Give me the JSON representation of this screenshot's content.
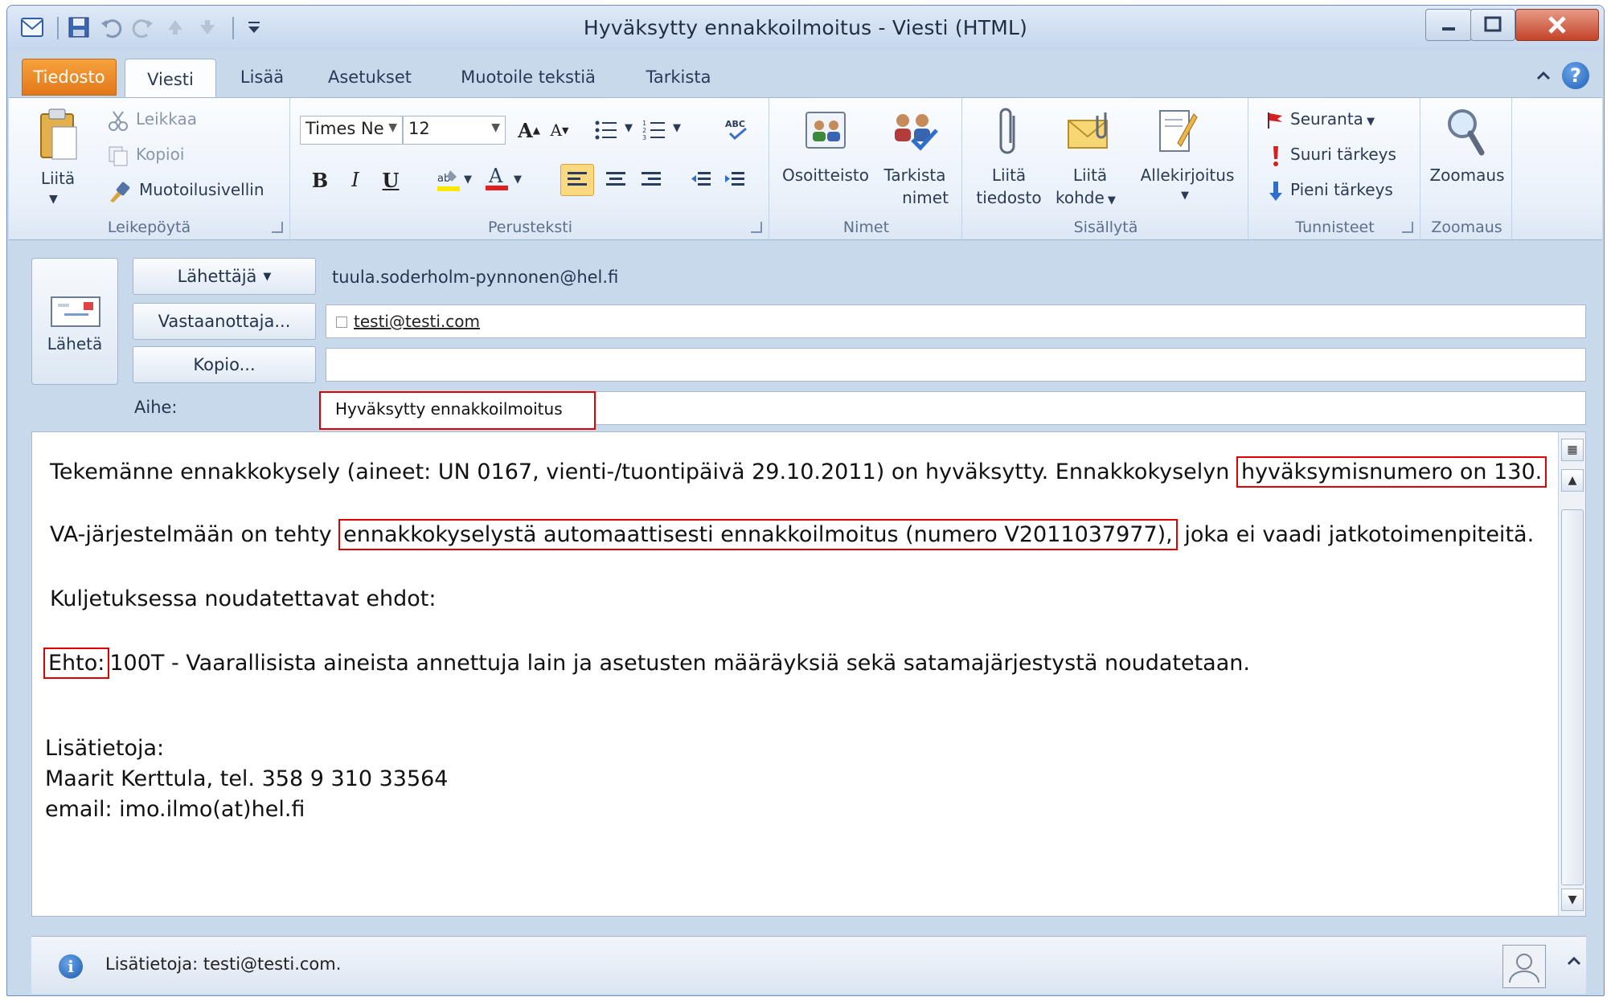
{
  "window": {
    "title": "Hyväksytty ennakkoilmoitus - Viesti (HTML)"
  },
  "tabs": [
    "Tiedosto",
    "Viesti",
    "Lisää",
    "Asetukset",
    "Muotoile tekstiä",
    "Tarkista"
  ],
  "ribbon": {
    "clipboard": {
      "paste": "Liitä",
      "cut": "Leikkaa",
      "copy": "Kopioi",
      "format_painter": "Muotoilusivellin",
      "group": "Leikepöytä"
    },
    "basic_text": {
      "font": "Times Ne",
      "size": "12",
      "group": "Perusteksti"
    },
    "names": {
      "address_book": "Osoitteisto",
      "check_names_1": "Tarkista",
      "check_names_2": "nimet",
      "group": "Nimet"
    },
    "include": {
      "attach_file_1": "Liitä",
      "attach_file_2": "tiedosto",
      "attach_item_1": "Liitä",
      "attach_item_2": "kohde",
      "signature": "Allekirjoitus",
      "group": "Sisällytä"
    },
    "tags": {
      "follow_up": "Seuranta",
      "high_importance": "Suuri tärkeys",
      "low_importance": "Pieni tärkeys",
      "group": "Tunnisteet"
    },
    "zoom": {
      "zoom": "Zoomaus",
      "group": "Zoomaus"
    }
  },
  "header": {
    "send": "Lähetä",
    "from_button": "Lähettäjä",
    "from_value": "tuula.soderholm-pynnonen@hel.fi",
    "to_button": "Vastaanottaja...",
    "to_value": "testi@testi.com",
    "cc_button": "Kopio...",
    "cc_value": "",
    "subject_label": "Aihe:",
    "subject_value": "Hyväksytty ennakkoilmoitus"
  },
  "body": {
    "l1_a": "Tekemänne ennakkokysely (aineet: UN 0167, vienti-/tuontipäivä 29.10.2011) on hyväksytty. Ennakkokyselyn",
    "l1_b": "hyväksymisnumero on 130.",
    "l2_a": "VA-järjestelmään on tehty",
    "l2_b": "ennakkokyselystä automaattisesti ennakkoilmoitus (numero V2011037977),",
    "l2_c": "joka ei vaadi jatkotoimenpiteitä.",
    "l3": "Kuljetuksessa noudatettavat ehdot:",
    "l4_a": "Ehto:",
    "l4_b": "100T - Vaarallisista aineista annettuja lain ja asetusten määräyksiä sekä satamajärjestystä noudatetaan.",
    "l5": "Lisätietoja:",
    "l6": "Maarit Kerttula, tel.  358 9 310 33564",
    "l7": "email: imo.ilmo(at)hel.fi"
  },
  "infobar": {
    "text": "Lisätietoja: testi@testi.com."
  },
  "colors": {
    "highlight": "#e00000",
    "file_tab": "#e2781a"
  }
}
